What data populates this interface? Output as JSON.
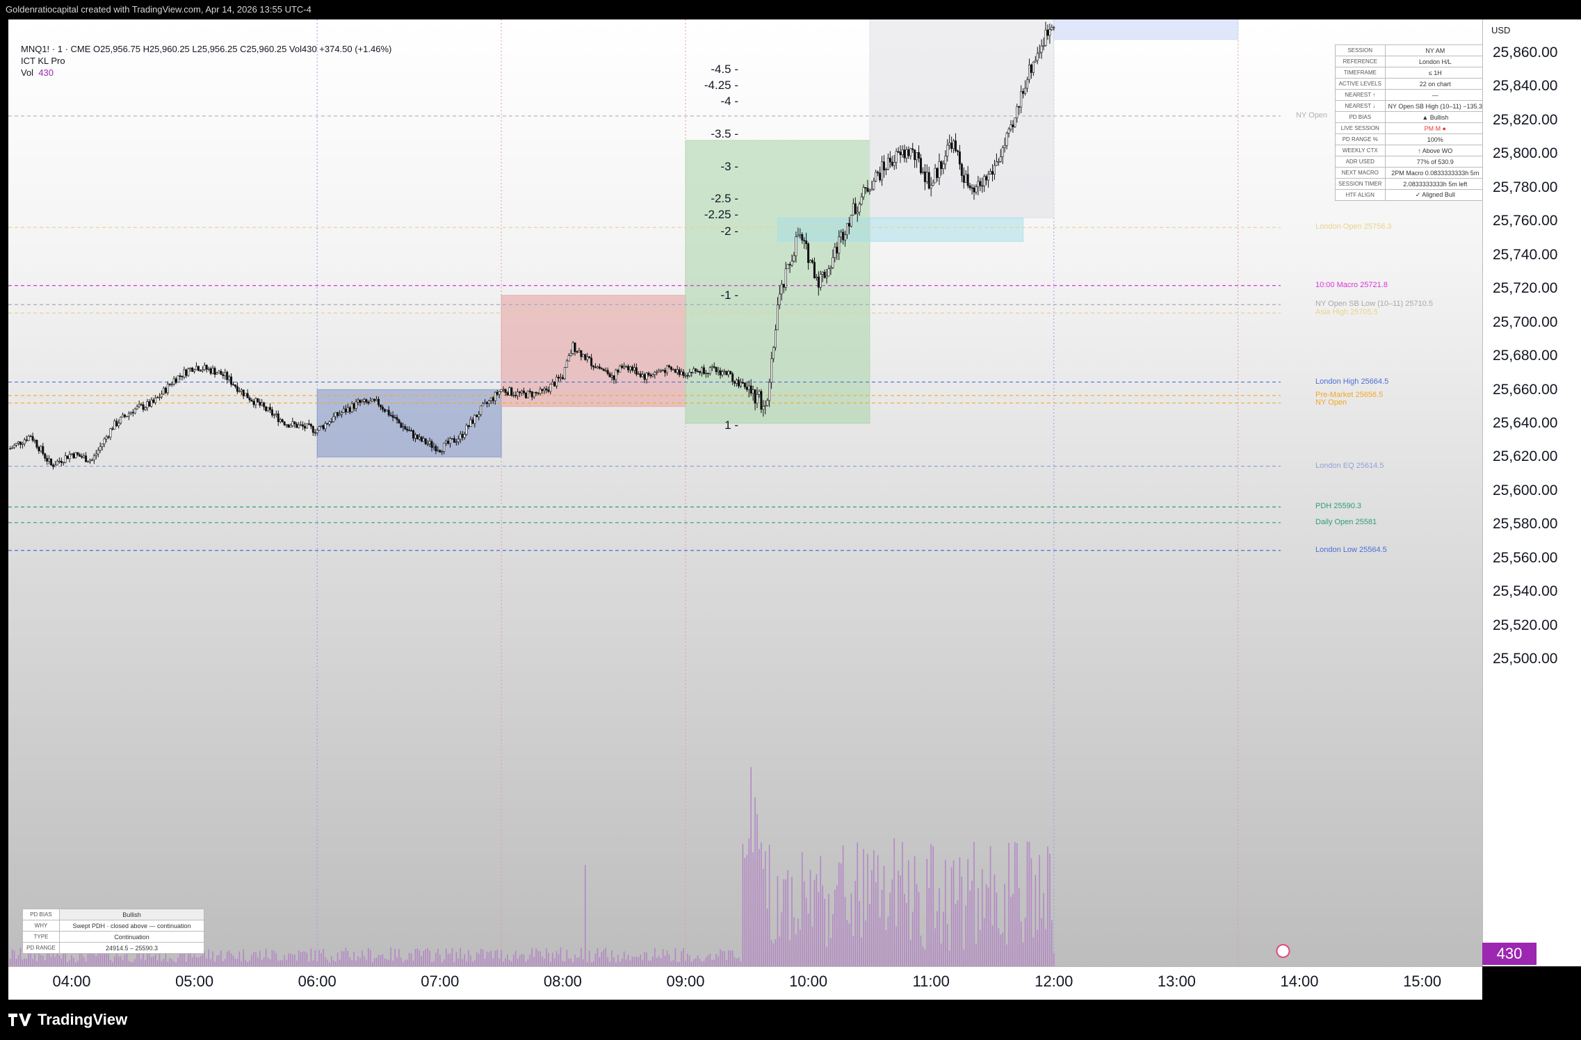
{
  "header": {
    "watermark": "Goldenratiocapital created with TradingView.com, Apr 14, 2026 13:55 UTC-4"
  },
  "legend": {
    "symbol_line": "MNQ1! · 1 · CME  O25,956.75  H25,960.25  L25,956.25  C25,960.25  Vol430  +374.50 (+1.46%)",
    "indicator": "ICT KL Pro",
    "vol_label": "Vol",
    "vol_value": "430"
  },
  "price_axis": {
    "currency": "USD",
    "ticks": [
      "25,860.00",
      "25,840.00",
      "25,820.00",
      "25,800.00",
      "25,780.00",
      "25,760.00",
      "25,740.00",
      "25,720.00",
      "25,700.00",
      "25,680.00",
      "25,660.00",
      "25,640.00",
      "25,620.00",
      "25,600.00",
      "25,580.00",
      "25,560.00",
      "25,540.00",
      "25,520.00",
      "25,500.00"
    ],
    "last_volume_badge": "430"
  },
  "time_axis": {
    "labels": [
      "04:00",
      "05:00",
      "06:00",
      "07:00",
      "08:00",
      "09:00",
      "10:00",
      "11:00",
      "12:00",
      "13:00",
      "14:00",
      "15:00"
    ]
  },
  "footer": {
    "brand": "TradingView"
  },
  "session_table": [
    {
      "k": "SESSION",
      "v": "NY AM"
    },
    {
      "k": "REFERENCE",
      "v": "London H/L"
    },
    {
      "k": "TIMEFRAME",
      "v": "≤ 1H"
    },
    {
      "k": "ACTIVE LEVELS",
      "v": "22 on chart"
    },
    {
      "k": "NEAREST ↑",
      "v": "—"
    },
    {
      "k": "NEAREST ↓",
      "v": "NY Open SB High (10–11)  −135.3"
    },
    {
      "k": "PD BIAS",
      "v": "▲ Bullish"
    },
    {
      "k": "LIVE SESSION",
      "v": "PM M ●"
    },
    {
      "k": "PD RANGE %",
      "v": "100%"
    },
    {
      "k": "WEEKLY CTX",
      "v": "↑ Above WO"
    },
    {
      "k": "ADR USED",
      "v": "77%  of  530.9"
    },
    {
      "k": "NEXT MACRO",
      "v": "2PM Macro  0.0833333333h 5m"
    },
    {
      "k": "SESSION TIMER",
      "v": "2.0833333333h 5m left"
    },
    {
      "k": "HTF ALIGN",
      "v": "✓ Aligned  Bull"
    }
  ],
  "bias_table": [
    {
      "k": "PD BIAS",
      "v": "Bullish"
    },
    {
      "k": "WHY",
      "v": "Swept PDH · closed above — continuation"
    },
    {
      "k": "TYPE",
      "v": "Continuation"
    },
    {
      "k": "PD RANGE",
      "v": "24914.5 – 25590.3"
    }
  ],
  "levels": [
    {
      "name": "NY Open",
      "text": "NY Open",
      "price": 25822.5,
      "color": "#b0b0b0"
    },
    {
      "name": "london-open",
      "text": "London Open  25756.3",
      "price": 25756.3,
      "color": "#e8d28a"
    },
    {
      "name": "macro-1000",
      "text": "10:00 Macro  25721.8",
      "price": 25721.8,
      "color": "#d633d6"
    },
    {
      "name": "ny-open-sb-low",
      "text": "NY Open SB Low (10–11)  25710.5",
      "price": 25710.5,
      "color": "#a8a8a8"
    },
    {
      "name": "asia-high",
      "text": "Asia High  25705.5",
      "price": 25705.5,
      "color": "#e8d28a"
    },
    {
      "name": "london-high",
      "text": "London High  25664.5",
      "price": 25664.5,
      "color": "#4a6fd8"
    },
    {
      "name": "pre-market",
      "text": "Pre-Market  25656.5",
      "price": 25656.5,
      "color": "#f5a623"
    },
    {
      "name": "ny-open-2",
      "text": "NY Open",
      "price": 25652.0,
      "color": "#f5a623"
    },
    {
      "name": "london-eq",
      "text": "London EQ  25614.5",
      "price": 25614.5,
      "color": "#8fa3d8"
    },
    {
      "name": "pdh",
      "text": "PDH  25590.3",
      "price": 25590.3,
      "color": "#2e9e72"
    },
    {
      "name": "daily-open",
      "text": "Daily Open  25581",
      "price": 25581.0,
      "color": "#2e9e72"
    },
    {
      "name": "london-low",
      "text": "London Low  25564.5",
      "price": 25564.5,
      "color": "#4a6fd8"
    }
  ],
  "fib_levels": [
    "-4.5",
    "-4.25",
    "-4",
    "-3.5",
    "-3",
    "-2.5",
    "-2.25",
    "-2",
    "-1",
    "1"
  ],
  "chart_data": {
    "type": "candlestick",
    "symbol": "MNQ1!",
    "timeframe": "1",
    "ylim": [
      25500,
      25880
    ],
    "x_range": [
      "03:30",
      "15:30"
    ],
    "ohlc_last": {
      "open": 25956.75,
      "high": 25960.25,
      "low": 25956.25,
      "close": 25960.25,
      "volume": 430
    },
    "close_path": [
      [
        "03:30",
        25625
      ],
      [
        "03:40",
        25633
      ],
      [
        "03:50",
        25615
      ],
      [
        "04:00",
        25622
      ],
      [
        "04:10",
        25618
      ],
      [
        "04:20",
        25638
      ],
      [
        "04:30",
        25648
      ],
      [
        "04:40",
        25652
      ],
      [
        "04:50",
        25666
      ],
      [
        "05:00",
        25674
      ],
      [
        "05:10",
        25671
      ],
      [
        "05:15",
        25668
      ],
      [
        "05:25",
        25657
      ],
      [
        "05:35",
        25648
      ],
      [
        "05:45",
        25640
      ],
      [
        "06:00",
        25636
      ],
      [
        "06:10",
        25645
      ],
      [
        "06:20",
        25652
      ],
      [
        "06:30",
        25652
      ],
      [
        "06:40",
        25640
      ],
      [
        "06:50",
        25630
      ],
      [
        "07:00",
        25625
      ],
      [
        "07:10",
        25632
      ],
      [
        "07:20",
        25648
      ],
      [
        "07:30",
        25660
      ],
      [
        "07:40",
        25657
      ],
      [
        "07:50",
        25658
      ],
      [
        "08:00",
        25668
      ],
      [
        "08:05",
        25686
      ],
      [
        "08:15",
        25675
      ],
      [
        "08:25",
        25668
      ],
      [
        "08:30",
        25675
      ],
      [
        "08:40",
        25668
      ],
      [
        "08:50",
        25672
      ],
      [
        "09:00",
        25670
      ],
      [
        "09:10",
        25672
      ],
      [
        "09:20",
        25670
      ],
      [
        "09:30",
        25660
      ],
      [
        "09:40",
        25650
      ],
      [
        "09:45",
        25710
      ],
      [
        "09:55",
        25752
      ],
      [
        "10:00",
        25740
      ],
      [
        "10:05",
        25725
      ],
      [
        "10:10",
        25732
      ],
      [
        "10:15",
        25748
      ],
      [
        "10:20",
        25762
      ],
      [
        "10:30",
        25782
      ],
      [
        "10:40",
        25796
      ],
      [
        "10:50",
        25802
      ],
      [
        "11:00",
        25782
      ],
      [
        "11:10",
        25808
      ],
      [
        "11:15",
        25790
      ],
      [
        "11:20",
        25775
      ],
      [
        "11:30",
        25790
      ],
      [
        "11:40",
        25815
      ],
      [
        "11:45",
        25840
      ],
      [
        "11:50",
        25855
      ],
      [
        "12:00",
        25880
      ]
    ],
    "volume_bars_max": 1800,
    "zones": [
      {
        "name": "asia-range-box",
        "from": "06:00",
        "to": "07:30",
        "low": 25620,
        "high": 25660,
        "color": "#8093c8"
      },
      {
        "name": "premarket-box",
        "from": "07:30",
        "to": "09:00",
        "low": 25650,
        "high": 25716,
        "color": "#e6a0a0"
      },
      {
        "name": "ny-killzone-box",
        "from": "09:00",
        "to": "10:30",
        "low": 25640,
        "high": 25808,
        "color": "#a8d4a8"
      },
      {
        "name": "ny-am-grey-box",
        "from": "10:30",
        "to": "12:00",
        "low": 25762,
        "high": 25880,
        "color": "#e0e0e6"
      },
      {
        "name": "fvg-box",
        "from": "09:45",
        "to": "11:45",
        "low": 25748,
        "high": 25762,
        "color": "#a8dfe8"
      },
      {
        "name": "upper-blue-box",
        "from": "12:00",
        "to": "13:30",
        "low": 25868,
        "high": 25880,
        "color": "#c8d4f8"
      }
    ]
  }
}
